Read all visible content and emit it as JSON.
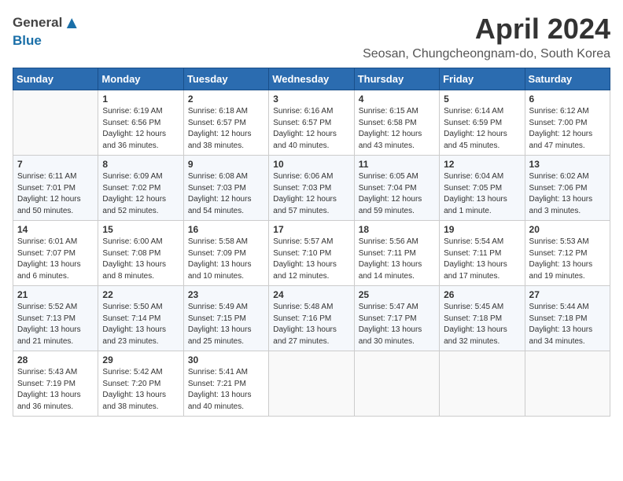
{
  "header": {
    "logo_general": "General",
    "logo_blue": "Blue",
    "month_title": "April 2024",
    "location": "Seosan, Chungcheongnam-do, South Korea"
  },
  "weekdays": [
    "Sunday",
    "Monday",
    "Tuesday",
    "Wednesday",
    "Thursday",
    "Friday",
    "Saturday"
  ],
  "weeks": [
    [
      {
        "day": "",
        "info": ""
      },
      {
        "day": "1",
        "info": "Sunrise: 6:19 AM\nSunset: 6:56 PM\nDaylight: 12 hours\nand 36 minutes."
      },
      {
        "day": "2",
        "info": "Sunrise: 6:18 AM\nSunset: 6:57 PM\nDaylight: 12 hours\nand 38 minutes."
      },
      {
        "day": "3",
        "info": "Sunrise: 6:16 AM\nSunset: 6:57 PM\nDaylight: 12 hours\nand 40 minutes."
      },
      {
        "day": "4",
        "info": "Sunrise: 6:15 AM\nSunset: 6:58 PM\nDaylight: 12 hours\nand 43 minutes."
      },
      {
        "day": "5",
        "info": "Sunrise: 6:14 AM\nSunset: 6:59 PM\nDaylight: 12 hours\nand 45 minutes."
      },
      {
        "day": "6",
        "info": "Sunrise: 6:12 AM\nSunset: 7:00 PM\nDaylight: 12 hours\nand 47 minutes."
      }
    ],
    [
      {
        "day": "7",
        "info": "Sunrise: 6:11 AM\nSunset: 7:01 PM\nDaylight: 12 hours\nand 50 minutes."
      },
      {
        "day": "8",
        "info": "Sunrise: 6:09 AM\nSunset: 7:02 PM\nDaylight: 12 hours\nand 52 minutes."
      },
      {
        "day": "9",
        "info": "Sunrise: 6:08 AM\nSunset: 7:03 PM\nDaylight: 12 hours\nand 54 minutes."
      },
      {
        "day": "10",
        "info": "Sunrise: 6:06 AM\nSunset: 7:03 PM\nDaylight: 12 hours\nand 57 minutes."
      },
      {
        "day": "11",
        "info": "Sunrise: 6:05 AM\nSunset: 7:04 PM\nDaylight: 12 hours\nand 59 minutes."
      },
      {
        "day": "12",
        "info": "Sunrise: 6:04 AM\nSunset: 7:05 PM\nDaylight: 13 hours\nand 1 minute."
      },
      {
        "day": "13",
        "info": "Sunrise: 6:02 AM\nSunset: 7:06 PM\nDaylight: 13 hours\nand 3 minutes."
      }
    ],
    [
      {
        "day": "14",
        "info": "Sunrise: 6:01 AM\nSunset: 7:07 PM\nDaylight: 13 hours\nand 6 minutes."
      },
      {
        "day": "15",
        "info": "Sunrise: 6:00 AM\nSunset: 7:08 PM\nDaylight: 13 hours\nand 8 minutes."
      },
      {
        "day": "16",
        "info": "Sunrise: 5:58 AM\nSunset: 7:09 PM\nDaylight: 13 hours\nand 10 minutes."
      },
      {
        "day": "17",
        "info": "Sunrise: 5:57 AM\nSunset: 7:10 PM\nDaylight: 13 hours\nand 12 minutes."
      },
      {
        "day": "18",
        "info": "Sunrise: 5:56 AM\nSunset: 7:11 PM\nDaylight: 13 hours\nand 14 minutes."
      },
      {
        "day": "19",
        "info": "Sunrise: 5:54 AM\nSunset: 7:11 PM\nDaylight: 13 hours\nand 17 minutes."
      },
      {
        "day": "20",
        "info": "Sunrise: 5:53 AM\nSunset: 7:12 PM\nDaylight: 13 hours\nand 19 minutes."
      }
    ],
    [
      {
        "day": "21",
        "info": "Sunrise: 5:52 AM\nSunset: 7:13 PM\nDaylight: 13 hours\nand 21 minutes."
      },
      {
        "day": "22",
        "info": "Sunrise: 5:50 AM\nSunset: 7:14 PM\nDaylight: 13 hours\nand 23 minutes."
      },
      {
        "day": "23",
        "info": "Sunrise: 5:49 AM\nSunset: 7:15 PM\nDaylight: 13 hours\nand 25 minutes."
      },
      {
        "day": "24",
        "info": "Sunrise: 5:48 AM\nSunset: 7:16 PM\nDaylight: 13 hours\nand 27 minutes."
      },
      {
        "day": "25",
        "info": "Sunrise: 5:47 AM\nSunset: 7:17 PM\nDaylight: 13 hours\nand 30 minutes."
      },
      {
        "day": "26",
        "info": "Sunrise: 5:45 AM\nSunset: 7:18 PM\nDaylight: 13 hours\nand 32 minutes."
      },
      {
        "day": "27",
        "info": "Sunrise: 5:44 AM\nSunset: 7:18 PM\nDaylight: 13 hours\nand 34 minutes."
      }
    ],
    [
      {
        "day": "28",
        "info": "Sunrise: 5:43 AM\nSunset: 7:19 PM\nDaylight: 13 hours\nand 36 minutes."
      },
      {
        "day": "29",
        "info": "Sunrise: 5:42 AM\nSunset: 7:20 PM\nDaylight: 13 hours\nand 38 minutes."
      },
      {
        "day": "30",
        "info": "Sunrise: 5:41 AM\nSunset: 7:21 PM\nDaylight: 13 hours\nand 40 minutes."
      },
      {
        "day": "",
        "info": ""
      },
      {
        "day": "",
        "info": ""
      },
      {
        "day": "",
        "info": ""
      },
      {
        "day": "",
        "info": ""
      }
    ]
  ]
}
